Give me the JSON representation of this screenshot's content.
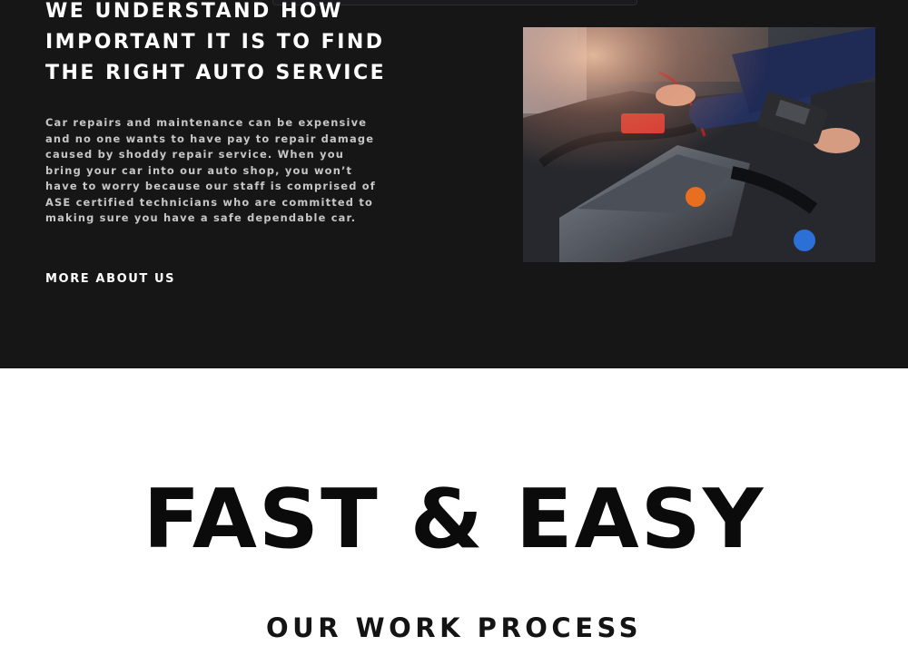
{
  "about": {
    "heading": {
      "line1": "WE UNDERSTAND HOW",
      "line2": "IMPORTANT IT IS TO FIND",
      "line3": "THE RIGHT AUTO SERVICE"
    },
    "body": "Car repairs and maintenance can be expensive and no one wants to have pay to repair damage caused by shoddy repair service. When you bring your car into our auto shop, you won’t have to worry because our staff is comprised of ASE certified technicians who are committed to making sure you have a safe dependable car.",
    "more_link": "MORE ABOUT US",
    "photo_icon": "engine-photo"
  },
  "process": {
    "title": "FAST & EASY",
    "subtitle": "OUR WORK PROCESS"
  },
  "colors": {
    "dark_background": "#161617",
    "light_background": "#ffffff",
    "heading_text": "#ffffff",
    "body_text": "#c6c6c6",
    "title_text": "#0b0b0b"
  }
}
